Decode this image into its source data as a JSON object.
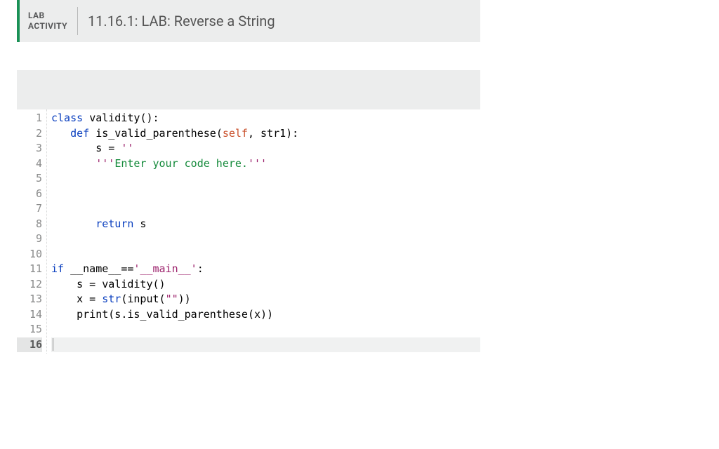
{
  "header": {
    "label_line1": "LAB",
    "label_line2": "ACTIVITY",
    "title": "11.16.1: LAB: Reverse a String"
  },
  "editor": {
    "line_count": 16,
    "active_line": 16,
    "lines": [
      {
        "tokens": [
          {
            "cls": "kw",
            "t": "class"
          },
          {
            "cls": "txt",
            "t": " "
          },
          {
            "cls": "fn",
            "t": "validity"
          },
          {
            "cls": "txt",
            "t": "():"
          }
        ]
      },
      {
        "tokens": [
          {
            "cls": "txt",
            "t": "   "
          },
          {
            "cls": "kw",
            "t": "def"
          },
          {
            "cls": "txt",
            "t": " "
          },
          {
            "cls": "fn",
            "t": "is_valid_parenthese"
          },
          {
            "cls": "txt",
            "t": "("
          },
          {
            "cls": "sp",
            "t": "self"
          },
          {
            "cls": "txt",
            "t": ", str1):"
          }
        ]
      },
      {
        "tokens": [
          {
            "cls": "txt",
            "t": "       s = "
          },
          {
            "cls": "str",
            "t": "''"
          }
        ]
      },
      {
        "tokens": [
          {
            "cls": "txt",
            "t": "       "
          },
          {
            "cls": "str",
            "t": "'''"
          },
          {
            "cls": "cmt",
            "t": "Enter your code here."
          },
          {
            "cls": "str",
            "t": "'''"
          }
        ]
      },
      {
        "tokens": []
      },
      {
        "tokens": []
      },
      {
        "tokens": []
      },
      {
        "tokens": [
          {
            "cls": "txt",
            "t": "       "
          },
          {
            "cls": "kw",
            "t": "return"
          },
          {
            "cls": "txt",
            "t": " s"
          }
        ]
      },
      {
        "tokens": []
      },
      {
        "tokens": []
      },
      {
        "tokens": [
          {
            "cls": "kw",
            "t": "if"
          },
          {
            "cls": "txt",
            "t": " __name__=="
          },
          {
            "cls": "str",
            "t": "'__main__'"
          },
          {
            "cls": "txt",
            "t": ":"
          }
        ]
      },
      {
        "tokens": [
          {
            "cls": "txt",
            "t": "    s = validity()"
          }
        ]
      },
      {
        "tokens": [
          {
            "cls": "txt",
            "t": "    x = "
          },
          {
            "cls": "kw",
            "t": "str"
          },
          {
            "cls": "txt",
            "t": "(input("
          },
          {
            "cls": "str",
            "t": "\"\""
          },
          {
            "cls": "txt",
            "t": "))"
          }
        ]
      },
      {
        "tokens": [
          {
            "cls": "txt",
            "t": "    print(s.is_valid_parenthese(x))"
          }
        ]
      },
      {
        "tokens": []
      },
      {
        "tokens": [],
        "cursor": true
      }
    ]
  }
}
